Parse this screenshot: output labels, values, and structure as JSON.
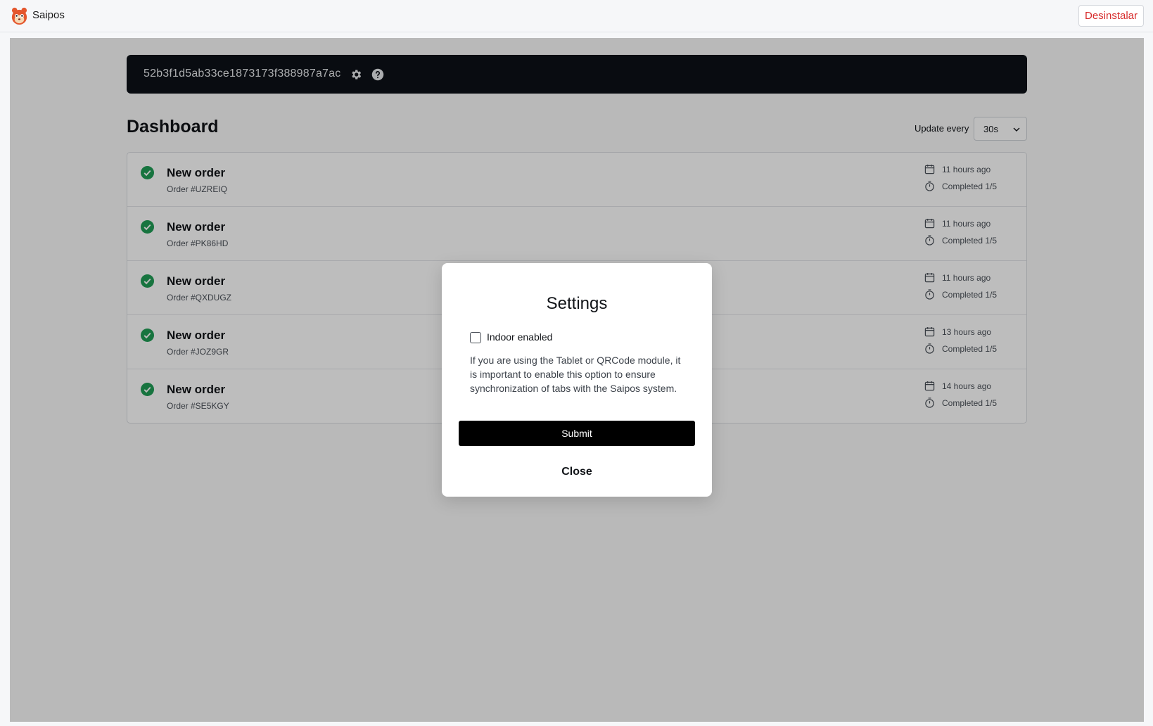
{
  "header": {
    "app_name": "Saipos",
    "logo_icon": "saipos-squirrel-logo",
    "uninstall_label": "Desinstalar"
  },
  "token_bar": {
    "token": "52b3f1d5ab33ce1873173f388987a7ac",
    "icons": [
      "gear-icon",
      "help-icon"
    ]
  },
  "dashboard": {
    "title": "Dashboard",
    "update_label": "Update every",
    "update_value": "30s"
  },
  "orders": [
    {
      "title": "New order",
      "number": "Order #UZREIQ",
      "time": "11 hours ago",
      "status": "Completed 1/5"
    },
    {
      "title": "New order",
      "number": "Order #PK86HD",
      "time": "11 hours ago",
      "status": "Completed 1/5"
    },
    {
      "title": "New order",
      "number": "Order #QXDUGZ",
      "time": "11 hours ago",
      "status": "Completed 1/5"
    },
    {
      "title": "New order",
      "number": "Order #JOZ9GR",
      "time": "13 hours ago",
      "status": "Completed 1/5"
    },
    {
      "title": "New order",
      "number": "Order #SE5KGY",
      "time": "14 hours ago",
      "status": "Completed 1/5"
    }
  ],
  "modal": {
    "title": "Settings",
    "checkbox_label": "Indoor enabled",
    "checkbox_checked": false,
    "description": "If you are using the Tablet or QRCode module, it is important to enable this option to ensure synchronization of tabs with the Saipos system.",
    "submit_label": "Submit",
    "close_label": "Close"
  },
  "colors": {
    "danger": "#d72c2c",
    "success": "#1f9d55",
    "token_bar_bg": "#0d1117",
    "primary_button": "#000000"
  }
}
